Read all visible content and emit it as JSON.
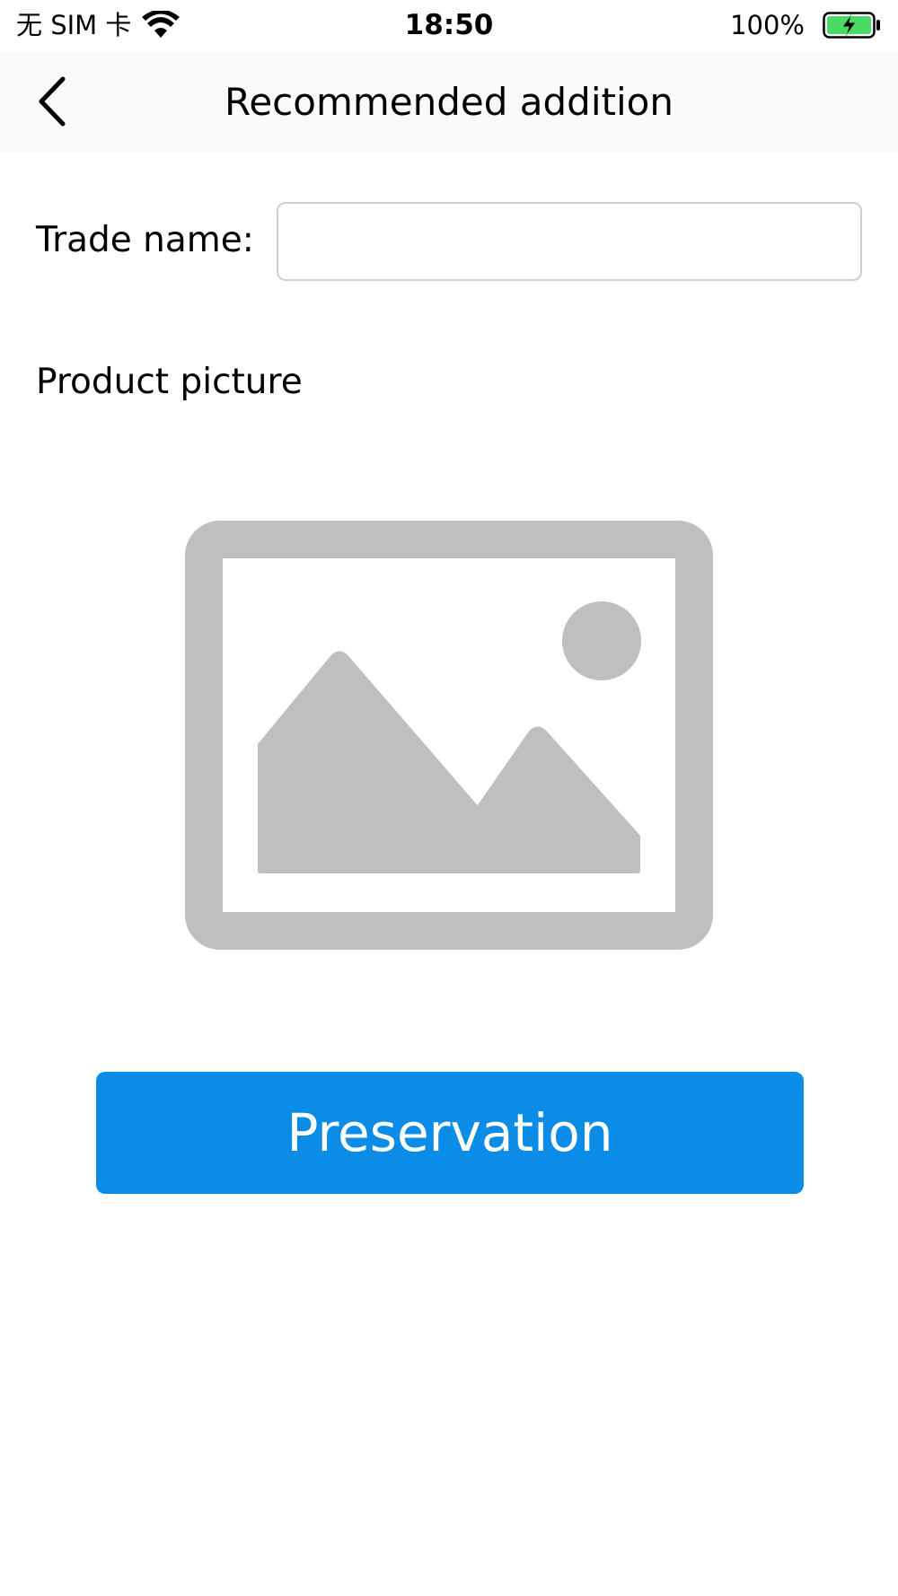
{
  "status_bar": {
    "carrier": "无 SIM 卡",
    "time": "18:50",
    "battery_percent": "100%",
    "battery_level": 1.0,
    "charging": true,
    "wifi_icon": "wifi-icon",
    "battery_icon": "battery-charging-icon"
  },
  "nav": {
    "title": "Recommended addition",
    "back_icon": "chevron-left-icon"
  },
  "form": {
    "trade_name_label": "Trade name:",
    "trade_name_value": "",
    "trade_name_placeholder": "",
    "product_picture_label": "Product picture",
    "picture_icon": "image-placeholder-icon"
  },
  "actions": {
    "save_label": "Preservation"
  },
  "colors": {
    "accent": "#0b8ce6",
    "placeholder_gray": "#bfbfbf",
    "battery_green": "#4cd964"
  }
}
